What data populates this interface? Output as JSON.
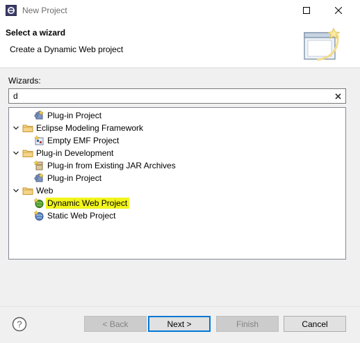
{
  "window": {
    "title": "New Project"
  },
  "header": {
    "title": "Select a wizard",
    "description": "Create a Dynamic Web project"
  },
  "wizards": {
    "label": "Wizards:",
    "filter_value": "d"
  },
  "tree": [
    {
      "label": "Plug-in Project",
      "depth": 1,
      "expanded": null,
      "icon": "plugin-project-icon"
    },
    {
      "label": "Eclipse Modeling Framework",
      "depth": 0,
      "expanded": true,
      "icon": "folder-icon"
    },
    {
      "label": "Empty EMF Project",
      "depth": 1,
      "expanded": null,
      "icon": "emf-project-icon"
    },
    {
      "label": "Plug-in Development",
      "depth": 0,
      "expanded": true,
      "icon": "folder-icon"
    },
    {
      "label": "Plug-in from Existing JAR Archives",
      "depth": 1,
      "expanded": null,
      "icon": "jar-plugin-icon"
    },
    {
      "label": "Plug-in Project",
      "depth": 1,
      "expanded": null,
      "icon": "plugin-project-icon"
    },
    {
      "label": "Web",
      "depth": 0,
      "expanded": true,
      "icon": "folder-icon"
    },
    {
      "label": "Dynamic Web Project",
      "depth": 1,
      "expanded": null,
      "icon": "dynamic-web-project-icon",
      "highlighted": true
    },
    {
      "label": "Static Web Project",
      "depth": 1,
      "expanded": null,
      "icon": "static-web-project-icon"
    }
  ],
  "buttons": {
    "back": "< Back",
    "next": "Next >",
    "finish": "Finish",
    "cancel": "Cancel"
  },
  "colors": {
    "highlight": "#f2f51c",
    "folder": "#e8b84a",
    "default_button_border": "#0078d7"
  }
}
